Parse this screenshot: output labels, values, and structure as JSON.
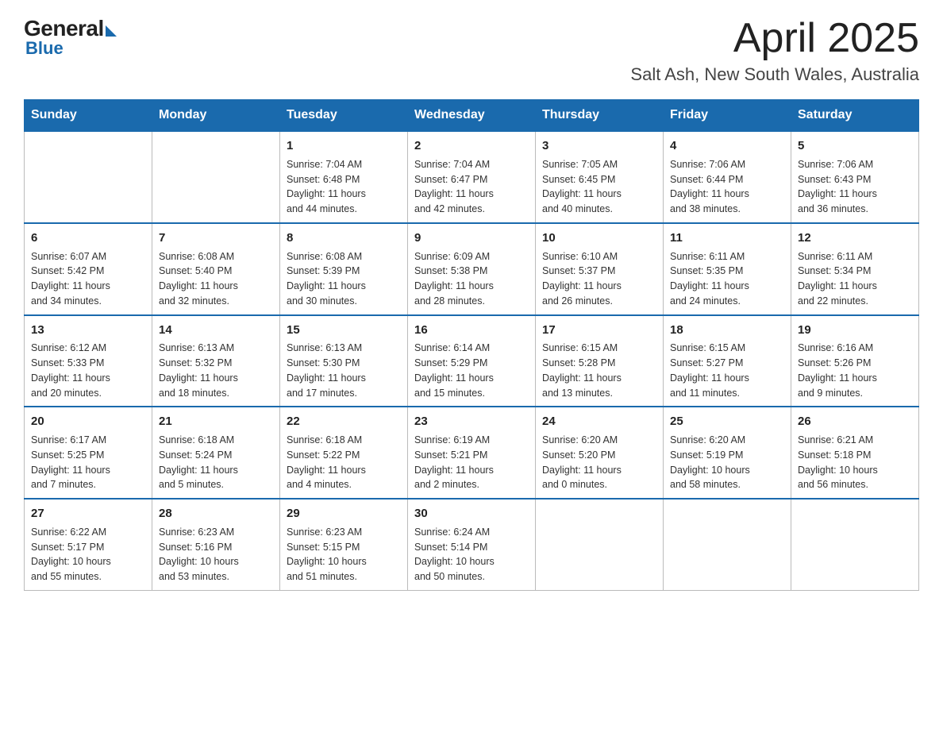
{
  "header": {
    "logo": {
      "general": "General",
      "blue": "Blue"
    },
    "title": "April 2025",
    "location": "Salt Ash, New South Wales, Australia"
  },
  "weekdays": [
    "Sunday",
    "Monday",
    "Tuesday",
    "Wednesday",
    "Thursday",
    "Friday",
    "Saturday"
  ],
  "weeks": [
    [
      {
        "day": "",
        "info": ""
      },
      {
        "day": "",
        "info": ""
      },
      {
        "day": "1",
        "info": "Sunrise: 7:04 AM\nSunset: 6:48 PM\nDaylight: 11 hours\nand 44 minutes."
      },
      {
        "day": "2",
        "info": "Sunrise: 7:04 AM\nSunset: 6:47 PM\nDaylight: 11 hours\nand 42 minutes."
      },
      {
        "day": "3",
        "info": "Sunrise: 7:05 AM\nSunset: 6:45 PM\nDaylight: 11 hours\nand 40 minutes."
      },
      {
        "day": "4",
        "info": "Sunrise: 7:06 AM\nSunset: 6:44 PM\nDaylight: 11 hours\nand 38 minutes."
      },
      {
        "day": "5",
        "info": "Sunrise: 7:06 AM\nSunset: 6:43 PM\nDaylight: 11 hours\nand 36 minutes."
      }
    ],
    [
      {
        "day": "6",
        "info": "Sunrise: 6:07 AM\nSunset: 5:42 PM\nDaylight: 11 hours\nand 34 minutes."
      },
      {
        "day": "7",
        "info": "Sunrise: 6:08 AM\nSunset: 5:40 PM\nDaylight: 11 hours\nand 32 minutes."
      },
      {
        "day": "8",
        "info": "Sunrise: 6:08 AM\nSunset: 5:39 PM\nDaylight: 11 hours\nand 30 minutes."
      },
      {
        "day": "9",
        "info": "Sunrise: 6:09 AM\nSunset: 5:38 PM\nDaylight: 11 hours\nand 28 minutes."
      },
      {
        "day": "10",
        "info": "Sunrise: 6:10 AM\nSunset: 5:37 PM\nDaylight: 11 hours\nand 26 minutes."
      },
      {
        "day": "11",
        "info": "Sunrise: 6:11 AM\nSunset: 5:35 PM\nDaylight: 11 hours\nand 24 minutes."
      },
      {
        "day": "12",
        "info": "Sunrise: 6:11 AM\nSunset: 5:34 PM\nDaylight: 11 hours\nand 22 minutes."
      }
    ],
    [
      {
        "day": "13",
        "info": "Sunrise: 6:12 AM\nSunset: 5:33 PM\nDaylight: 11 hours\nand 20 minutes."
      },
      {
        "day": "14",
        "info": "Sunrise: 6:13 AM\nSunset: 5:32 PM\nDaylight: 11 hours\nand 18 minutes."
      },
      {
        "day": "15",
        "info": "Sunrise: 6:13 AM\nSunset: 5:30 PM\nDaylight: 11 hours\nand 17 minutes."
      },
      {
        "day": "16",
        "info": "Sunrise: 6:14 AM\nSunset: 5:29 PM\nDaylight: 11 hours\nand 15 minutes."
      },
      {
        "day": "17",
        "info": "Sunrise: 6:15 AM\nSunset: 5:28 PM\nDaylight: 11 hours\nand 13 minutes."
      },
      {
        "day": "18",
        "info": "Sunrise: 6:15 AM\nSunset: 5:27 PM\nDaylight: 11 hours\nand 11 minutes."
      },
      {
        "day": "19",
        "info": "Sunrise: 6:16 AM\nSunset: 5:26 PM\nDaylight: 11 hours\nand 9 minutes."
      }
    ],
    [
      {
        "day": "20",
        "info": "Sunrise: 6:17 AM\nSunset: 5:25 PM\nDaylight: 11 hours\nand 7 minutes."
      },
      {
        "day": "21",
        "info": "Sunrise: 6:18 AM\nSunset: 5:24 PM\nDaylight: 11 hours\nand 5 minutes."
      },
      {
        "day": "22",
        "info": "Sunrise: 6:18 AM\nSunset: 5:22 PM\nDaylight: 11 hours\nand 4 minutes."
      },
      {
        "day": "23",
        "info": "Sunrise: 6:19 AM\nSunset: 5:21 PM\nDaylight: 11 hours\nand 2 minutes."
      },
      {
        "day": "24",
        "info": "Sunrise: 6:20 AM\nSunset: 5:20 PM\nDaylight: 11 hours\nand 0 minutes."
      },
      {
        "day": "25",
        "info": "Sunrise: 6:20 AM\nSunset: 5:19 PM\nDaylight: 10 hours\nand 58 minutes."
      },
      {
        "day": "26",
        "info": "Sunrise: 6:21 AM\nSunset: 5:18 PM\nDaylight: 10 hours\nand 56 minutes."
      }
    ],
    [
      {
        "day": "27",
        "info": "Sunrise: 6:22 AM\nSunset: 5:17 PM\nDaylight: 10 hours\nand 55 minutes."
      },
      {
        "day": "28",
        "info": "Sunrise: 6:23 AM\nSunset: 5:16 PM\nDaylight: 10 hours\nand 53 minutes."
      },
      {
        "day": "29",
        "info": "Sunrise: 6:23 AM\nSunset: 5:15 PM\nDaylight: 10 hours\nand 51 minutes."
      },
      {
        "day": "30",
        "info": "Sunrise: 6:24 AM\nSunset: 5:14 PM\nDaylight: 10 hours\nand 50 minutes."
      },
      {
        "day": "",
        "info": ""
      },
      {
        "day": "",
        "info": ""
      },
      {
        "day": "",
        "info": ""
      }
    ]
  ]
}
